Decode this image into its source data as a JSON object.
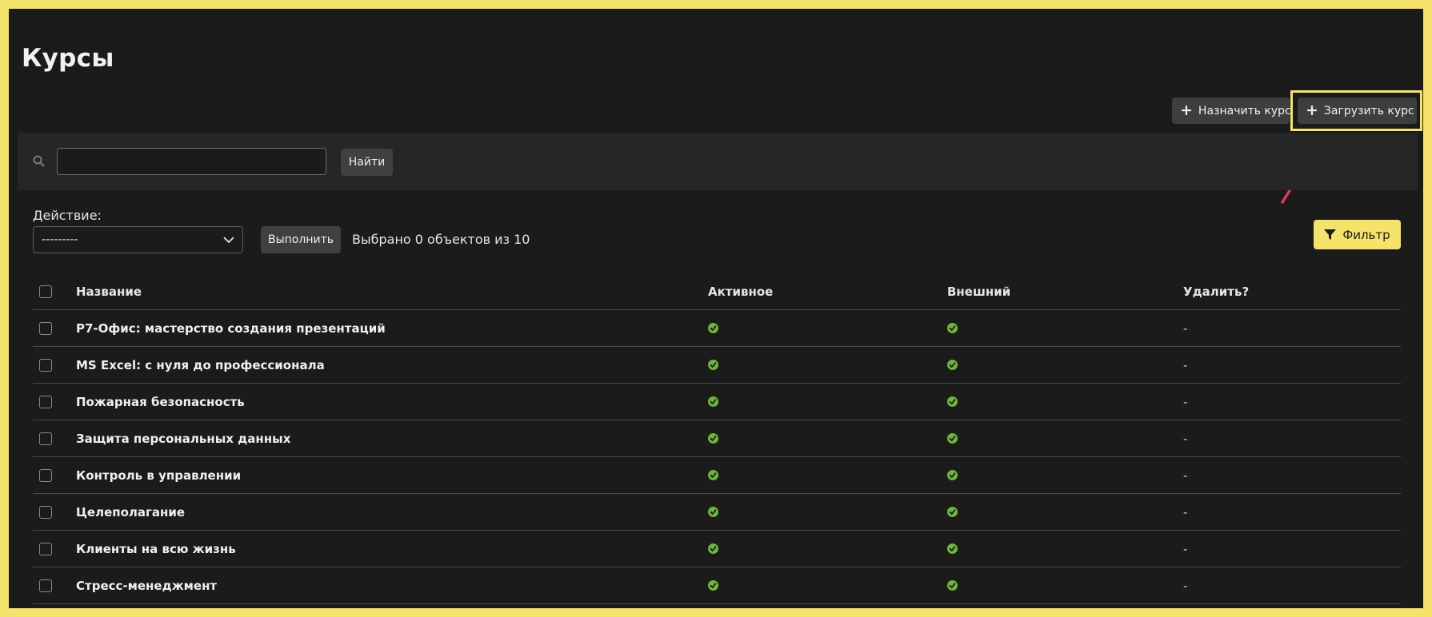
{
  "page": {
    "title": "Курсы"
  },
  "toolbar": {
    "assign_label": "Назначить курс",
    "upload_label": "Загрузить курс"
  },
  "search": {
    "value": "",
    "placeholder": "",
    "button_label": "Найти"
  },
  "actions": {
    "label": "Действие:",
    "select_value": "---------",
    "run_label": "Выполнить",
    "selected_text": "Выбрано 0 объектов из 10"
  },
  "filter": {
    "label": "Фильтр"
  },
  "table": {
    "columns": [
      "Название",
      "Активное",
      "Внешний",
      "Удалить?"
    ],
    "rows": [
      {
        "name": "Р7-Офис: мастерство создания презентаций",
        "active": true,
        "external": true,
        "delete": "-"
      },
      {
        "name": "MS Excel: с нуля до профессионала",
        "active": true,
        "external": true,
        "delete": "-"
      },
      {
        "name": "Пожарная безопасность",
        "active": true,
        "external": true,
        "delete": "-"
      },
      {
        "name": "Защита персональных данных",
        "active": true,
        "external": true,
        "delete": "-"
      },
      {
        "name": "Контроль в управлении",
        "active": true,
        "external": true,
        "delete": "-"
      },
      {
        "name": "Целеполагание",
        "active": true,
        "external": true,
        "delete": "-"
      },
      {
        "name": "Клиенты на всю жизнь",
        "active": true,
        "external": true,
        "delete": "-"
      },
      {
        "name": "Стресс-менеджмент",
        "active": true,
        "external": true,
        "delete": "-"
      }
    ]
  },
  "colors": {
    "background": "#1b1b1b",
    "accent_yellow": "#f6e36a",
    "check_green": "#6fb53a",
    "annotation_arrow": "#e8365a"
  }
}
